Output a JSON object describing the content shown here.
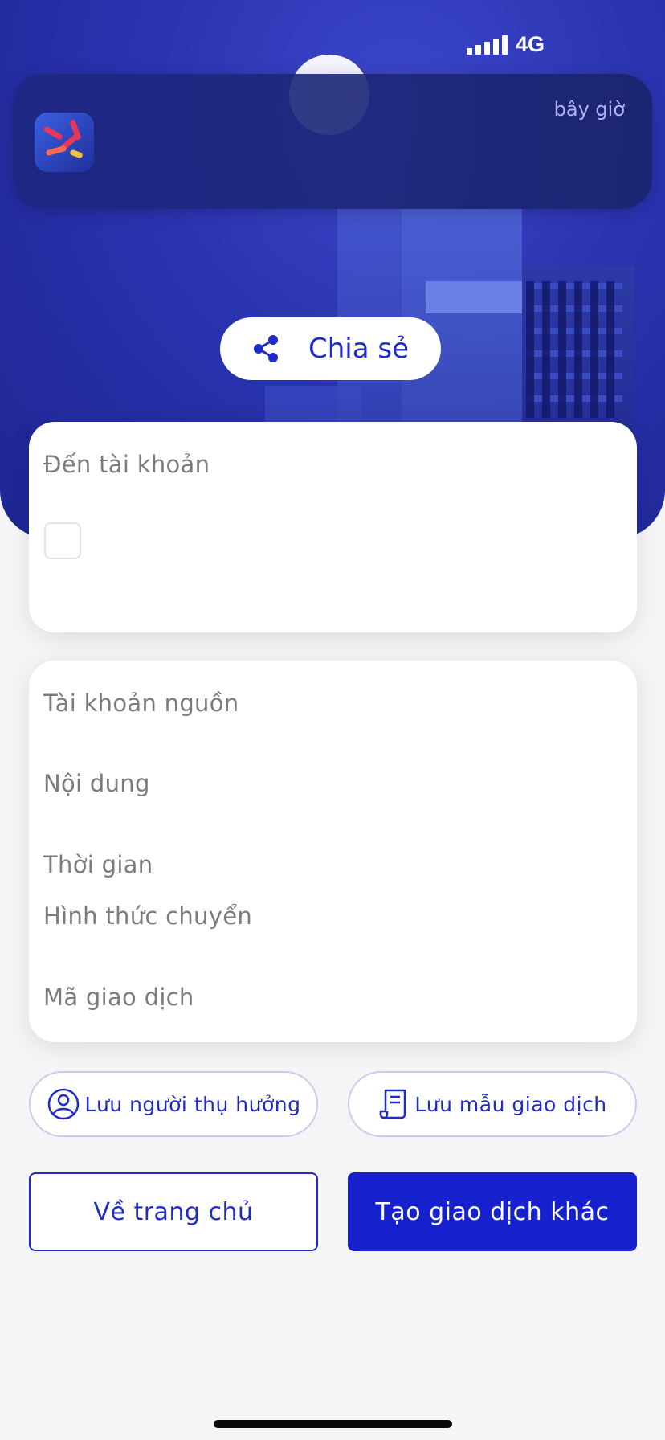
{
  "status_bar": {
    "network": "4G"
  },
  "notification": {
    "time": "bây giờ"
  },
  "share": {
    "label": "Chia sẻ"
  },
  "recipient_card": {
    "title": "Đến tài khoản"
  },
  "details_card": {
    "rows": [
      {
        "label": "Tài khoản nguồn"
      },
      {
        "label": "Nội dung"
      },
      {
        "label": "Thời gian"
      },
      {
        "label": "Hình thức chuyển"
      },
      {
        "label": "Mã giao dịch"
      }
    ]
  },
  "actions": {
    "save_beneficiary": "Lưu người thụ hưởng",
    "save_template": "Lưu mẫu giao dịch",
    "home": "Về trang chủ",
    "new_transaction": "Tạo giao dịch khác"
  },
  "colors": {
    "accent": "#1620cc",
    "hero": "#2a33b0"
  }
}
